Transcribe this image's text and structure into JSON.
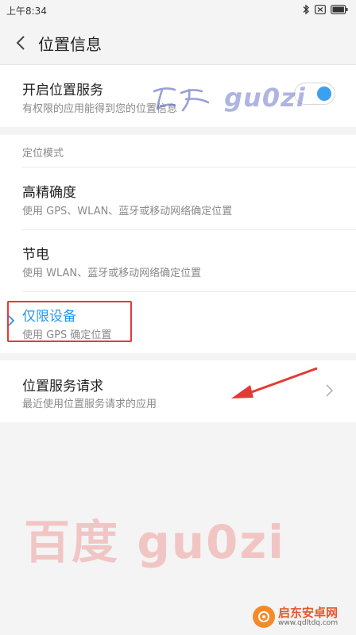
{
  "status_bar": {
    "time": "上午8:34",
    "icons": [
      "bluetooth-icon",
      "sim-icon",
      "battery-icon"
    ]
  },
  "header": {
    "title": "位置信息"
  },
  "location_service": {
    "title": "开启位置服务",
    "subtitle": "有权限的应用能得到您的位置信息",
    "enabled": true
  },
  "location_mode": {
    "label": "定位模式",
    "options": [
      {
        "title": "高精确度",
        "subtitle": "使用 GPS、WLAN、蓝牙或移动网络确定位置",
        "selected": false
      },
      {
        "title": "节电",
        "subtitle": "使用 WLAN、蓝牙或移动网络确定位置",
        "selected": false
      },
      {
        "title": "仅限设备",
        "subtitle": "使用 GPS 确定位置",
        "selected": true
      }
    ]
  },
  "location_requests": {
    "title": "位置服务请求",
    "subtitle": "最近使用位置服务请求的应用"
  },
  "watermarks": {
    "top": "gu0zi",
    "bottom": "百度 gu0zi"
  },
  "site_badge": {
    "name": "启东安卓网",
    "url": "www.qdltdq.com"
  },
  "colors": {
    "accent": "#2196f3",
    "annotation": "#e53935"
  }
}
